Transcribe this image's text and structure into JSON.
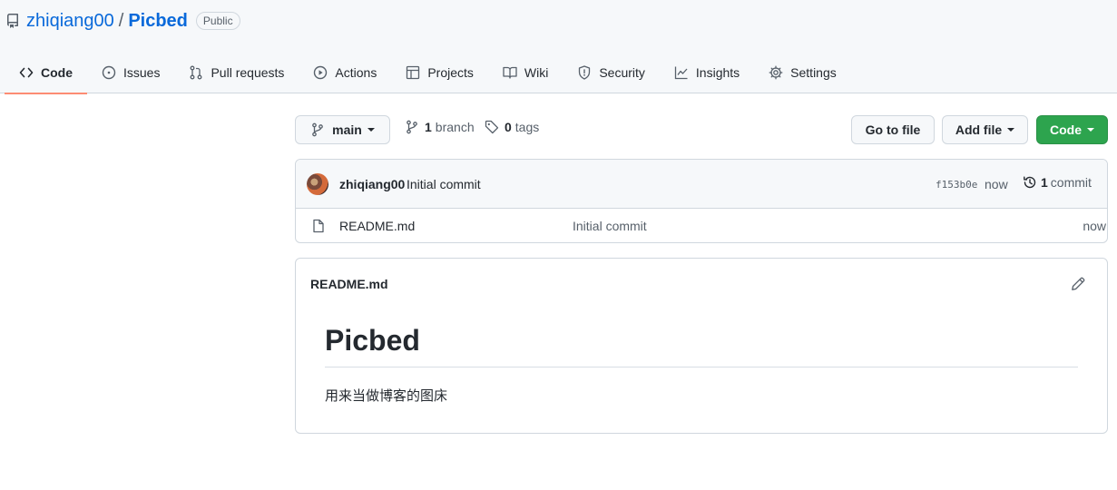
{
  "repo": {
    "owner": "zhiqiang00",
    "separator": "/",
    "name": "Picbed",
    "visibility": "Public"
  },
  "tabs": [
    {
      "label": "Code",
      "icon": "code-icon",
      "active": true
    },
    {
      "label": "Issues",
      "icon": "issue-icon"
    },
    {
      "label": "Pull requests",
      "icon": "pull-request-icon"
    },
    {
      "label": "Actions",
      "icon": "play-icon"
    },
    {
      "label": "Projects",
      "icon": "table-icon"
    },
    {
      "label": "Wiki",
      "icon": "book-icon"
    },
    {
      "label": "Security",
      "icon": "shield-icon"
    },
    {
      "label": "Insights",
      "icon": "graph-icon"
    },
    {
      "label": "Settings",
      "icon": "gear-icon"
    }
  ],
  "toolbar": {
    "branch_select": "main",
    "branch_count": "1",
    "branch_label": "branch",
    "tag_count": "0",
    "tag_label": "tags",
    "go_to_file": "Go to file",
    "add_file": "Add file",
    "code": "Code"
  },
  "latest_commit": {
    "author": "zhiqiang00",
    "message": "Initial commit",
    "sha": "f153b0e",
    "time": "now",
    "count": "1",
    "count_label": "commit"
  },
  "files": [
    {
      "name": "README.md",
      "commit": "Initial commit",
      "time": "now",
      "icon": "file-icon"
    }
  ],
  "readme": {
    "filename": "README.md",
    "heading": "Picbed",
    "paragraph": "用来当做博客的图床"
  },
  "colors": {
    "accent": "#0969da",
    "green": "#2da44e",
    "tab_underline": "#fd8c73"
  }
}
